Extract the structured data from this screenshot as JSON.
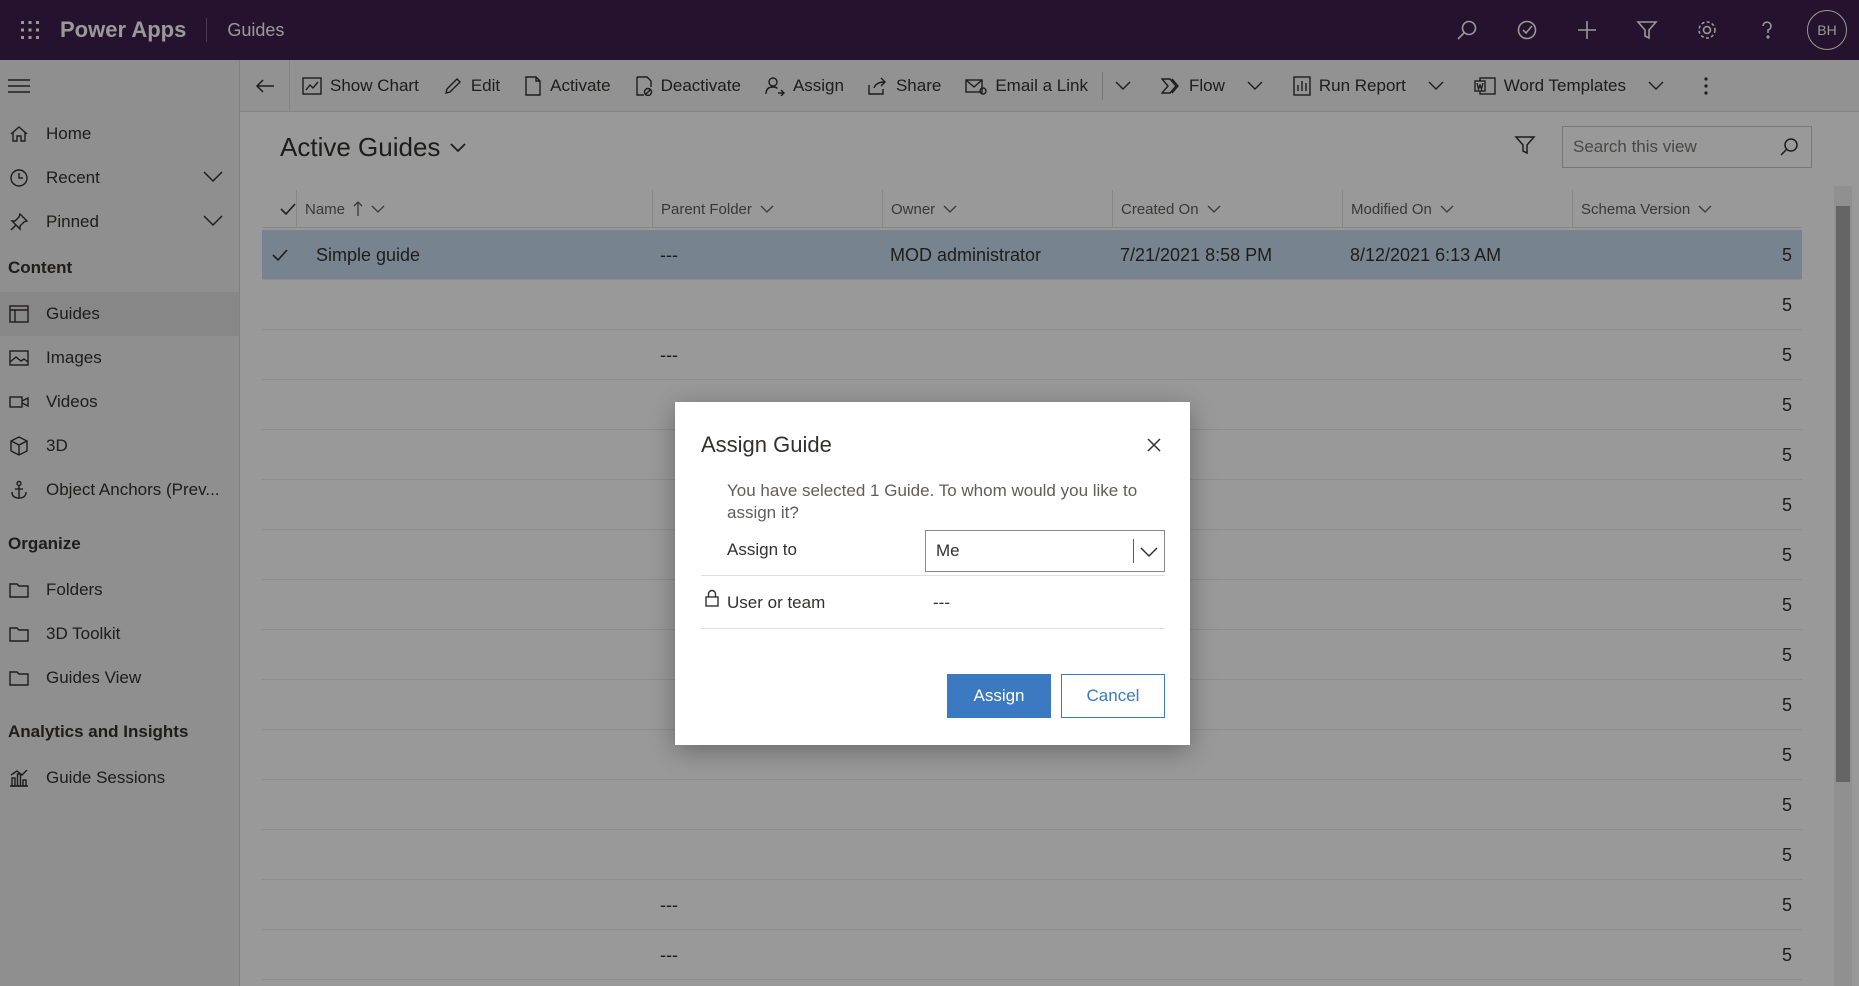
{
  "topbar": {
    "app_name": "Power Apps",
    "area_name": "Guides",
    "avatar_initials": "BH",
    "icons": [
      "search-icon",
      "assistant-icon",
      "new-icon",
      "filter-icon",
      "settings-icon",
      "help-icon"
    ]
  },
  "sidenav": {
    "top_items": [
      {
        "label": "Home",
        "icon": "home-icon"
      },
      {
        "label": "Recent",
        "icon": "clock-icon"
      },
      {
        "label": "Pinned",
        "icon": "pin-icon"
      }
    ],
    "groups": [
      {
        "title": "Content",
        "items": [
          {
            "label": "Guides",
            "icon": "guide-icon",
            "selected": true
          },
          {
            "label": "Images",
            "icon": "image-icon"
          },
          {
            "label": "Videos",
            "icon": "video-icon"
          },
          {
            "label": "3D",
            "icon": "cube-icon"
          },
          {
            "label": "Object Anchors (Prev...",
            "icon": "anchor-icon"
          }
        ]
      },
      {
        "title": "Organize",
        "items": [
          {
            "label": "Folders",
            "icon": "folder-icon"
          },
          {
            "label": "3D Toolkit",
            "icon": "folder-icon"
          },
          {
            "label": "Guides View",
            "icon": "folder-icon"
          }
        ]
      },
      {
        "title": "Analytics and Insights",
        "items": [
          {
            "label": "Guide Sessions",
            "icon": "chart-icon"
          }
        ]
      }
    ]
  },
  "commandbar": {
    "show_chart": "Show Chart",
    "edit": "Edit",
    "activate": "Activate",
    "deactivate": "Deactivate",
    "assign": "Assign",
    "share": "Share",
    "email_link": "Email a Link",
    "flow": "Flow",
    "run_report": "Run Report",
    "word_templates": "Word Templates"
  },
  "view": {
    "title": "Active Guides",
    "search_placeholder": "Search this view"
  },
  "grid": {
    "columns": [
      "Name",
      "Parent Folder",
      "Owner",
      "Created On",
      "Modified On",
      "Schema Version"
    ],
    "rows": [
      {
        "name": "Simple guide",
        "parent": "---",
        "owner": "MOD administrator",
        "created": "7/21/2021 8:58 PM",
        "modified": "8/12/2021 6:13 AM",
        "schema": "5",
        "selected": true
      },
      {
        "name": "",
        "parent": "",
        "owner": "",
        "created": "",
        "modified": "",
        "schema": "5"
      },
      {
        "name": "",
        "parent": "---",
        "owner": "",
        "created": "",
        "modified": "",
        "schema": "5"
      },
      {
        "name": "",
        "parent": "",
        "owner": "",
        "created": "",
        "modified": "",
        "schema": "5"
      },
      {
        "name": "",
        "parent": "",
        "owner": "",
        "created": "",
        "modified": "",
        "schema": "5"
      },
      {
        "name": "",
        "parent": "",
        "owner": "",
        "created": "",
        "modified": "",
        "schema": "5"
      },
      {
        "name": "",
        "parent": "",
        "owner": "",
        "created": "",
        "modified": "",
        "schema": "5"
      },
      {
        "name": "",
        "parent": "",
        "owner": "",
        "created": "",
        "modified": "",
        "schema": "5"
      },
      {
        "name": "",
        "parent": "",
        "owner": "",
        "created": "",
        "modified": "",
        "schema": "5"
      },
      {
        "name": "",
        "parent": "",
        "owner": "",
        "created": "",
        "modified": "",
        "schema": "5"
      },
      {
        "name": "",
        "parent": "",
        "owner": "",
        "created": "",
        "modified": "",
        "schema": "5"
      },
      {
        "name": "",
        "parent": "",
        "owner": "",
        "created": "",
        "modified": "",
        "schema": "5"
      },
      {
        "name": "",
        "parent": "",
        "owner": "",
        "created": "",
        "modified": "",
        "schema": "5"
      },
      {
        "name": "",
        "parent": "---",
        "owner": "",
        "created": "",
        "modified": "",
        "schema": "5"
      },
      {
        "name": "",
        "parent": "---",
        "owner": "",
        "created": "",
        "modified": "",
        "schema": "5"
      }
    ]
  },
  "dialog": {
    "title": "Assign Guide",
    "message": "You have selected 1 Guide. To whom would you like to assign it?",
    "assign_to_label": "Assign to",
    "assign_to_value": "Me",
    "user_team_label": "User or team",
    "user_team_value": "---",
    "assign_button": "Assign",
    "cancel_button": "Cancel"
  },
  "colors": {
    "topbar": "#3f1e4e",
    "primary": "#3b79c0",
    "selected_row": "#c7dcef"
  }
}
